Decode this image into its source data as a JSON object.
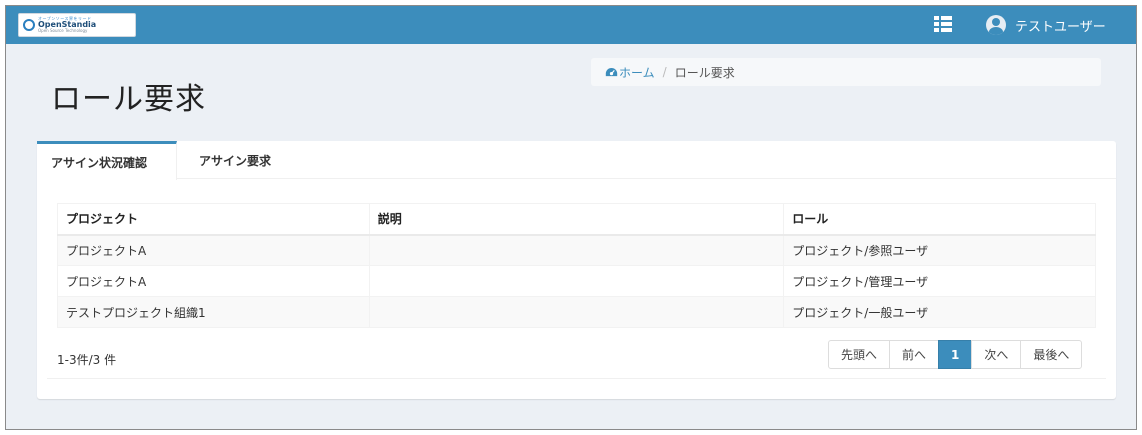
{
  "header": {
    "logo": {
      "tagline": "オープンソース界をリード",
      "name": "OpenStandia",
      "sub": "Open Source Technology"
    },
    "menu_icon": "list-icon",
    "user_name": "テストユーザー"
  },
  "page": {
    "title": "ロール要求"
  },
  "breadcrumb": {
    "home_label": "ホーム",
    "separator": "/",
    "current": "ロール要求"
  },
  "tabs": [
    {
      "label": "アサイン状況確認",
      "active": true
    },
    {
      "label": "アサイン要求",
      "active": false
    }
  ],
  "table": {
    "headers": [
      "プロジェクト",
      "説明",
      "ロール"
    ],
    "rows": [
      {
        "project": "プロジェクトA",
        "description": "",
        "role": "プロジェクト/参照ユーザ"
      },
      {
        "project": "プロジェクトA",
        "description": "",
        "role": "プロジェクト/管理ユーザ"
      },
      {
        "project": "テストプロジェクト組織1",
        "description": "",
        "role": "プロジェクト/一般ユーザ"
      }
    ]
  },
  "pagination": {
    "count_text": "1-3件/3 件",
    "first": "先頭へ",
    "prev": "前へ",
    "current": "1",
    "next": "次へ",
    "last": "最後へ"
  },
  "colors": {
    "brand": "#3c8dbc",
    "background": "#ecf0f5"
  }
}
